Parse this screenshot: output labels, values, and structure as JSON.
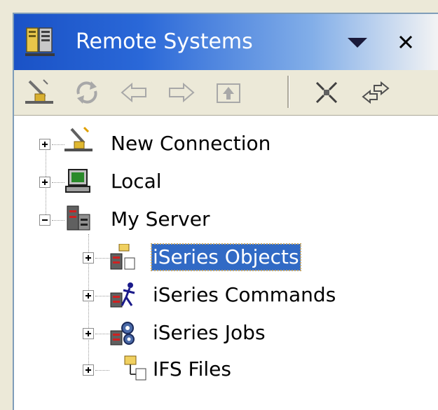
{
  "view": {
    "title": "Remote Systems",
    "title_icon": "remote-systems-icon",
    "controls": [
      {
        "name": "view-menu",
        "icon": "triangle-down-icon"
      },
      {
        "name": "close",
        "icon": "close-icon"
      }
    ]
  },
  "toolbar": {
    "buttons": [
      {
        "name": "new-connection",
        "icon": "new-connection-icon",
        "enabled": true
      },
      {
        "name": "refresh",
        "icon": "refresh-icon",
        "enabled": false
      },
      {
        "name": "back",
        "icon": "back-arrow-icon",
        "enabled": false
      },
      {
        "name": "forward",
        "icon": "forward-arrow-icon",
        "enabled": false
      },
      {
        "name": "up-one-level",
        "icon": "up-folder-icon",
        "enabled": false
      },
      {
        "name": "collapse-all",
        "icon": "collapse-all-icon",
        "enabled": true
      },
      {
        "name": "link-with-editor",
        "icon": "link-arrows-icon",
        "enabled": true
      }
    ]
  },
  "tree": {
    "items": [
      {
        "label": "New Connection",
        "icon": "new-connection-icon",
        "expanded": false,
        "level": 0
      },
      {
        "label": "Local",
        "icon": "computer-icon",
        "expanded": false,
        "level": 0
      },
      {
        "label": "My Server",
        "icon": "server-icon",
        "expanded": true,
        "level": 0,
        "children": [
          {
            "label": "iSeries Objects",
            "icon": "iseries-objects-icon",
            "expanded": false,
            "selected": true
          },
          {
            "label": "iSeries Commands",
            "icon": "iseries-commands-icon",
            "expanded": false
          },
          {
            "label": "iSeries Jobs",
            "icon": "iseries-jobs-icon",
            "expanded": false
          },
          {
            "label": "IFS Files",
            "icon": "ifs-files-icon",
            "expanded": false
          }
        ]
      }
    ]
  },
  "colors": {
    "titlebar_start": "#1a52c6",
    "titlebar_end": "#f4f4f4",
    "selection": "#316ac5",
    "toolbar_bg": "#ece9d8"
  }
}
